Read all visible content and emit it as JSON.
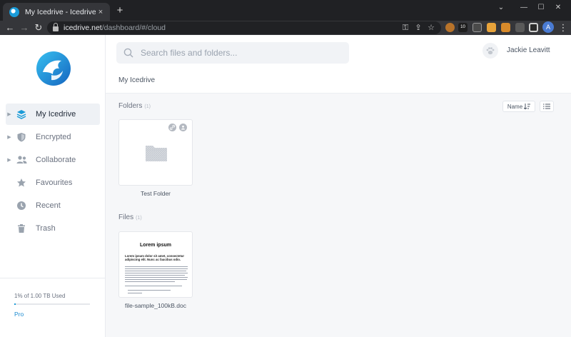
{
  "browser": {
    "tab_title": "My Icedrive - Icedrive",
    "tab_close": "×",
    "new_tab": "+",
    "url_host": "icedrive.net",
    "url_path": "/dashboard/#/cloud",
    "window_controls": [
      "⌄",
      "—",
      "☐",
      "✕"
    ],
    "profile_initial": "A",
    "extension_badge": "10"
  },
  "search": {
    "placeholder": "Search files and folders..."
  },
  "user": {
    "name": "Jackie Leavitt"
  },
  "breadcrumb": "My Icedrive",
  "sidebar": {
    "items": [
      {
        "label": "My Icedrive",
        "icon": "layers-icon",
        "active": true,
        "expandable": true
      },
      {
        "label": "Encrypted",
        "icon": "shield-icon",
        "active": false,
        "expandable": true
      },
      {
        "label": "Collaborate",
        "icon": "users-icon",
        "active": false,
        "expandable": true
      },
      {
        "label": "Favourites",
        "icon": "star-icon",
        "active": false,
        "expandable": false
      },
      {
        "label": "Recent",
        "icon": "clock-icon",
        "active": false,
        "expandable": false
      },
      {
        "label": "Trash",
        "icon": "trash-icon",
        "active": false,
        "expandable": false
      }
    ],
    "usage_text": "1% of 1.00 TB Used",
    "usage_fraction": 0.01,
    "plan": "Pro"
  },
  "folders_section": {
    "title": "Folders",
    "count": "(1)"
  },
  "files_section": {
    "title": "Files",
    "count": "(1)"
  },
  "sort": {
    "label": "Name"
  },
  "folders": [
    {
      "name": "Test Folder"
    }
  ],
  "files": [
    {
      "name": "file-sample_100kB.doc",
      "preview_heading": "Lorem ipsum",
      "preview_sub": "Lorem ipsum dolor sit amet, consectetur adipiscing elit. Nunc ac faucibus odio."
    }
  ],
  "colors": {
    "accent": "#1a9bd8",
    "active_bg": "#eef1f5",
    "page_bg": "#f6f7f9"
  }
}
